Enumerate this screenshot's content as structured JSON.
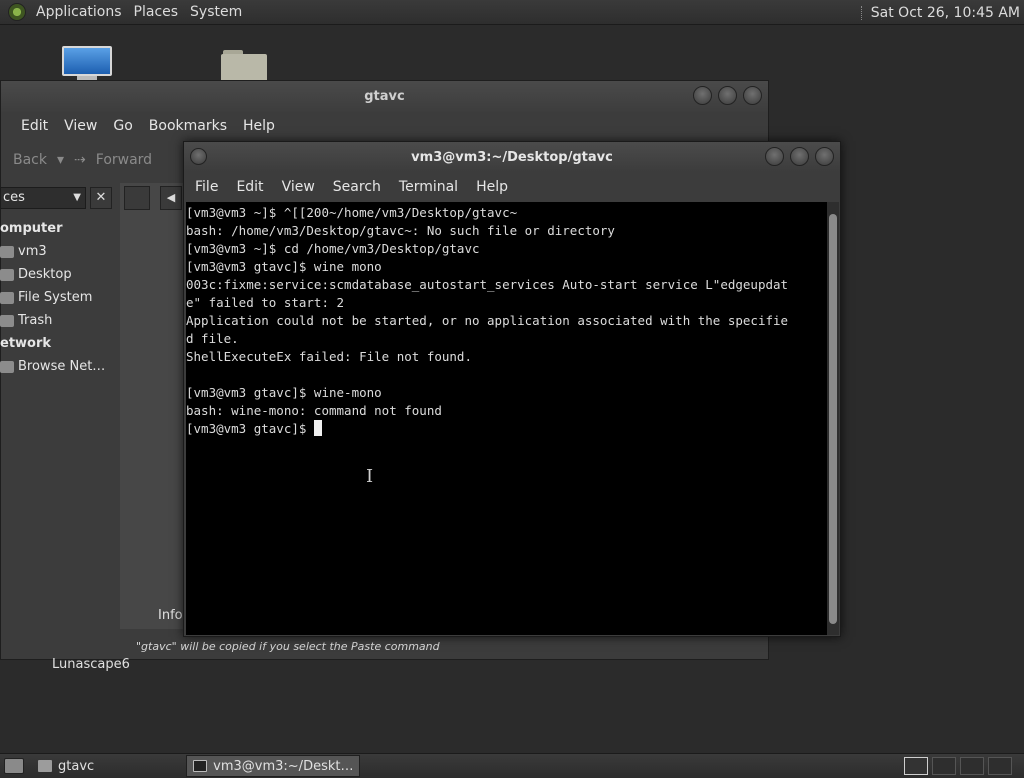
{
  "top_panel": {
    "menus": [
      "Applications",
      "Places",
      "System"
    ],
    "clock": "Sat Oct 26, 10:45 AM"
  },
  "desktop": {
    "icons": [
      {
        "name": "computer-icon"
      },
      {
        "name": "folder-icon"
      }
    ],
    "label_lunascape": "Lunascape6"
  },
  "file_manager": {
    "title": "gtavc",
    "menus": [
      "Edit",
      "View",
      "Go",
      "Bookmarks",
      "Help"
    ],
    "toolbar": {
      "back": "Back",
      "forward": "Forward"
    },
    "side_combo": "ces",
    "sidebar": [
      {
        "type": "head",
        "label": "omputer"
      },
      {
        "type": "item",
        "label": "vm3"
      },
      {
        "type": "item",
        "label": "Desktop"
      },
      {
        "type": "item",
        "label": "File System"
      },
      {
        "type": "item",
        "label": "Trash"
      },
      {
        "type": "head",
        "label": "etwork"
      },
      {
        "type": "item",
        "label": "Browse Net…"
      }
    ],
    "info_label": "Info",
    "status": "\"gtavc\" will be copied if you select the Paste command"
  },
  "terminal": {
    "title": "vm3@vm3:~/Desktop/gtavc",
    "menus": [
      "File",
      "Edit",
      "View",
      "Search",
      "Terminal",
      "Help"
    ],
    "lines": [
      "[vm3@vm3 ~]$ ^[[200~/home/vm3/Desktop/gtavc~",
      "bash: /home/vm3/Desktop/gtavc~: No such file or directory",
      "[vm3@vm3 ~]$ cd /home/vm3/Desktop/gtavc",
      "[vm3@vm3 gtavc]$ wine mono",
      "003c:fixme:service:scmdatabase_autostart_services Auto-start service L\"edgeupdat",
      "e\" failed to start: 2",
      "Application could not be started, or no application associated with the specifie",
      "d file.",
      "ShellExecuteEx failed: File not found.",
      "",
      "[vm3@vm3 gtavc]$ wine-mono",
      "bash: wine-mono: command not found"
    ],
    "prompt": "[vm3@vm3 gtavc]$ "
  },
  "bottom_panel": {
    "tasks": [
      {
        "label": "gtavc",
        "active": false
      },
      {
        "label": "vm3@vm3:~/Deskt…",
        "active": true
      }
    ]
  }
}
